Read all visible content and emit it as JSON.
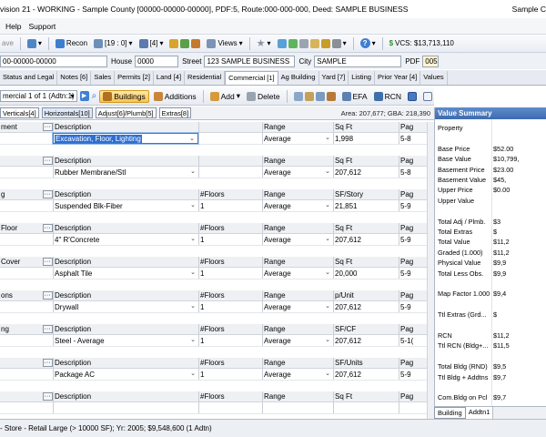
{
  "window": {
    "title": "vision 21 - WORKING - Sample County [00000-00000-00000], PDF:5, Route:000-000-000, Deed: SAMPLE BUSINESS",
    "title_right": "Sample C"
  },
  "menu": [
    "Help",
    "Support"
  ],
  "toolbar": {
    "save": "ave",
    "recon": "Recon",
    "pages": "[19 : 0]",
    "count": "[4]",
    "views": "Views",
    "vcs": "VCS: $13,713,110"
  },
  "parcel": {
    "id": "00-00000-00000",
    "house_label": "House",
    "house": "0000",
    "street_label": "Street",
    "street": "123 SAMPLE BUSINESS",
    "city_label": "City",
    "city": "SAMPLE",
    "pdf_label": "PDF",
    "pdf": "005"
  },
  "tabs": [
    "Status and Legal",
    "Notes [6]",
    "Sales",
    "Permits [2]",
    "Land [4]",
    "Residential",
    "Commercial [1]",
    "Ag Building",
    "Yard [7]",
    "Listing",
    "Prior Year [4]",
    "Values"
  ],
  "active_tab": "Commercial [1]",
  "commercial_toolbar": {
    "selector": "mercial 1 of 1 (Adtn:1)",
    "buildings": "Buildings",
    "additions": "Additions",
    "add": "Add",
    "delete": "Delete",
    "efa": "EFA",
    "rcn": "RCN"
  },
  "subtabs": [
    "Verticals[4]",
    "Horizontals[10]",
    "Adjust[6]/Plumb[5]",
    "Extras[8]"
  ],
  "active_subtab": "Horizontals[10]",
  "area_text": "Area: 207,677; GBA: 218,390",
  "groups": [
    {
      "name": "ment",
      "desc_label": "Description",
      "mid_label": "",
      "range_label": "Range",
      "qty_label": "Sq Ft",
      "pag_label": "Pag",
      "desc": "Excavation, Floor, Lighting",
      "mid": "",
      "range": "Average",
      "qty": "1,998",
      "pag": "5-8",
      "selected": true
    },
    {
      "name": "",
      "desc_label": "Description",
      "mid_label": "",
      "range_label": "Range",
      "qty_label": "Sq Ft",
      "pag_label": "Pag",
      "desc": "Rubber Membrane/Stl",
      "mid": "",
      "range": "Average",
      "qty": "207,612",
      "pag": "5-8"
    },
    {
      "name": "g",
      "desc_label": "Description",
      "mid_label": "#Floors",
      "range_label": "Range",
      "qty_label": "SF/Story",
      "pag_label": "Pag",
      "desc": "Suspended Blk-Fiber",
      "mid": "1",
      "range": "Average",
      "qty": "21,851",
      "pag": "5-9"
    },
    {
      "name": "Floor",
      "desc_label": "Description",
      "mid_label": "#Floors",
      "range_label": "Range",
      "qty_label": "Sq Ft",
      "pag_label": "Pag",
      "desc": "4\" R'Concrete",
      "mid": "1",
      "range": "Average",
      "qty": "207,612",
      "pag": "5-9"
    },
    {
      "name": "Cover",
      "desc_label": "Description",
      "mid_label": "#Floors",
      "range_label": "Range",
      "qty_label": "Sq Ft",
      "pag_label": "Pag",
      "desc": "Asphalt Tile",
      "mid": "1",
      "range": "Average",
      "qty": "20,000",
      "pag": "5-9"
    },
    {
      "name": "ons",
      "desc_label": "Description",
      "mid_label": "#Floors",
      "range_label": "Range",
      "qty_label": "p/Unit",
      "pag_label": "Pag",
      "desc": "Drywall",
      "mid": "1",
      "range": "Average",
      "qty": "207,612",
      "pag": "5-9"
    },
    {
      "name": "ng",
      "desc_label": "Description",
      "mid_label": "#Floors",
      "range_label": "Range",
      "qty_label": "SF/CF",
      "pag_label": "Pag",
      "desc": "Steel - Average",
      "mid": "1",
      "range": "Average",
      "qty": "207,612",
      "pag": "5-1("
    },
    {
      "name": "",
      "desc_label": "Description",
      "mid_label": "#Floors",
      "range_label": "Range",
      "qty_label": "SF/Units",
      "pag_label": "Pag",
      "desc": "Package AC",
      "mid": "1",
      "range": "Average",
      "qty": "207,612",
      "pag": "5-9"
    },
    {
      "name": "",
      "desc_label": "Description",
      "mid_label": "#Floors",
      "range_label": "Range",
      "qty_label": "Sq Ft",
      "pag_label": "Pag",
      "desc": "",
      "mid": "",
      "range": "",
      "qty": "",
      "pag": ""
    }
  ],
  "value_summary": {
    "title": "Value Summary",
    "rows": [
      {
        "k": "Property",
        "v": ""
      },
      {
        "k": "",
        "v": ""
      },
      {
        "k": "Base Price",
        "v": "$52.00"
      },
      {
        "k": "Base Value",
        "v": "$10,799,"
      },
      {
        "k": "Basement Price",
        "v": "$23.00"
      },
      {
        "k": "Basement Value",
        "v": "$45,"
      },
      {
        "k": "Upper Price",
        "v": "$0.00"
      },
      {
        "k": "Upper Value",
        "v": ""
      },
      {
        "k": "",
        "v": ""
      },
      {
        "k": "Total Adj / Plmb.",
        "v": "$3"
      },
      {
        "k": "Total Extras",
        "v": "$"
      },
      {
        "k": "Total Value",
        "v": "$11,2"
      },
      {
        "k": "Graded (1.000)",
        "v": "$11,2"
      },
      {
        "k": "Physical Value",
        "v": "$9,9"
      },
      {
        "k": "Total Less Obs.",
        "v": "$9,9"
      },
      {
        "k": "",
        "v": ""
      },
      {
        "k": "Map Factor 1.000",
        "v": "$9,4"
      },
      {
        "k": "",
        "v": ""
      },
      {
        "k": "Ttl Extras (Grd...",
        "v": "$"
      },
      {
        "k": "",
        "v": ""
      },
      {
        "k": "RCN",
        "v": "$11,2"
      },
      {
        "k": "Ttl RCN (Bldg+...",
        "v": "$11,5"
      },
      {
        "k": "",
        "v": ""
      },
      {
        "k": "Total Bldg (RND)",
        "v": "$9,5"
      },
      {
        "k": "Ttl Bldg + Addtns",
        "v": "$9,7"
      },
      {
        "k": "",
        "v": ""
      },
      {
        "k": "Com.Bldg on Pcl",
        "v": "$9,7"
      }
    ],
    "tabs": [
      "Building",
      "Addtn1"
    ]
  },
  "status": "- Store - Retail Large (> 10000 SF); Yr: 2005; $9,548,600 (1 Adtn)"
}
